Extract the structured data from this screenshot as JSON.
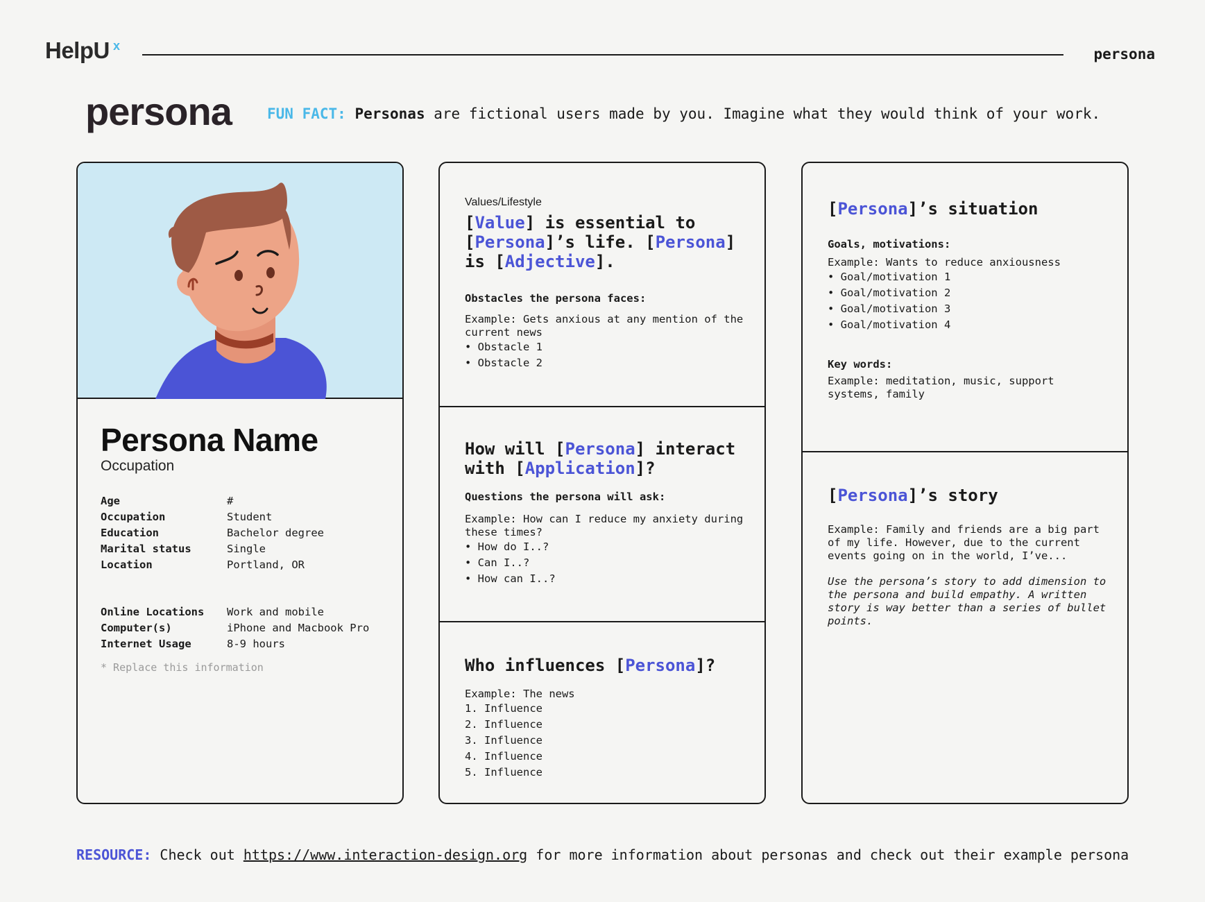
{
  "header": {
    "logo": "HelpU",
    "logo_sup": "x",
    "page_label": "persona"
  },
  "title": "persona",
  "fun_fact": {
    "label": "FUN FACT:",
    "bold": "Personas",
    "text": " are fictional users made by you. Imagine what they would think of your work."
  },
  "profile": {
    "name": "Persona Name",
    "occupation_label": "Occupation",
    "details": [
      {
        "key": "Age",
        "value": "#"
      },
      {
        "key": "Occupation",
        "value": "Student"
      },
      {
        "key": "Education",
        "value": "Bachelor degree"
      },
      {
        "key": "Marital status",
        "value": "Single"
      },
      {
        "key": "Location",
        "value": "Portland, OR"
      }
    ],
    "online": [
      {
        "key": "Online Locations",
        "value": "Work and mobile"
      },
      {
        "key": "Computer(s)",
        "value": "iPhone and Macbook Pro"
      },
      {
        "key": "Internet Usage",
        "value": "8-9 hours"
      }
    ],
    "note": "* Replace this information",
    "colors": {
      "bg": "#cde9f4",
      "hair": "#9e5a45",
      "skin": "#eda487",
      "shirt": "#4b54d6"
    }
  },
  "values": {
    "label": "Values/Lifestyle",
    "s1": "[",
    "t1": "Value",
    "s2": "] is essential to",
    "s3": "[",
    "t2": "Persona",
    "s4": "]’s life. [",
    "t3": "Persona",
    "s5": "]",
    "s6": "is [",
    "t4": "Adjective",
    "s7": "].",
    "obstacles_h": "Obstacles the persona faces:",
    "obstacles_example": "Example: Gets anxious at any mention of the current news",
    "obstacles": [
      "• Obstacle 1",
      "• Obstacle 2"
    ]
  },
  "interact": {
    "p1": "How will [",
    "t1": "Persona",
    "p2": "] interact",
    "p3": "with [",
    "t2": "Application",
    "p4": "]?",
    "questions_h": "Questions the persona will ask:",
    "example": "Example: How can I reduce my anxiety during these times?",
    "items": [
      "• How do I..?",
      "• Can I..?",
      "• How can I..?"
    ]
  },
  "influences": {
    "p1": "Who influences [",
    "t1": "Persona",
    "p2": "]?",
    "example": "Example: The news",
    "items": [
      "1. Influence",
      "2. Influence",
      "3. Influence",
      "4. Influence",
      "5. Influence"
    ]
  },
  "situation": {
    "p1": "[",
    "t1": "Persona",
    "p2": "]’s situation",
    "goals_h": "Goals, motivations:",
    "goals_example": "Example: Wants to reduce anxiousness",
    "goals": [
      "• Goal/motivation 1",
      "• Goal/motivation 2",
      "• Goal/motivation 3",
      "• Goal/motivation 4"
    ],
    "keywords_h": "Key words:",
    "keywords_example": "Example: meditation, music, support systems, family"
  },
  "story": {
    "p1": "[",
    "t1": "Persona",
    "p2": "]’s story",
    "example": "Example: Family and friends are a big part of my life. However, due to the current events going on in the world, I’ve...",
    "tip": "Use the persona’s story to add dimension to the persona and build empathy. A written story is way better than a series of bullet points."
  },
  "footer": {
    "label": "RESOURCE:",
    "pre": " Check out ",
    "link": "https://www.interaction-design.org",
    "post": " for more information about personas and check out their example persona"
  }
}
